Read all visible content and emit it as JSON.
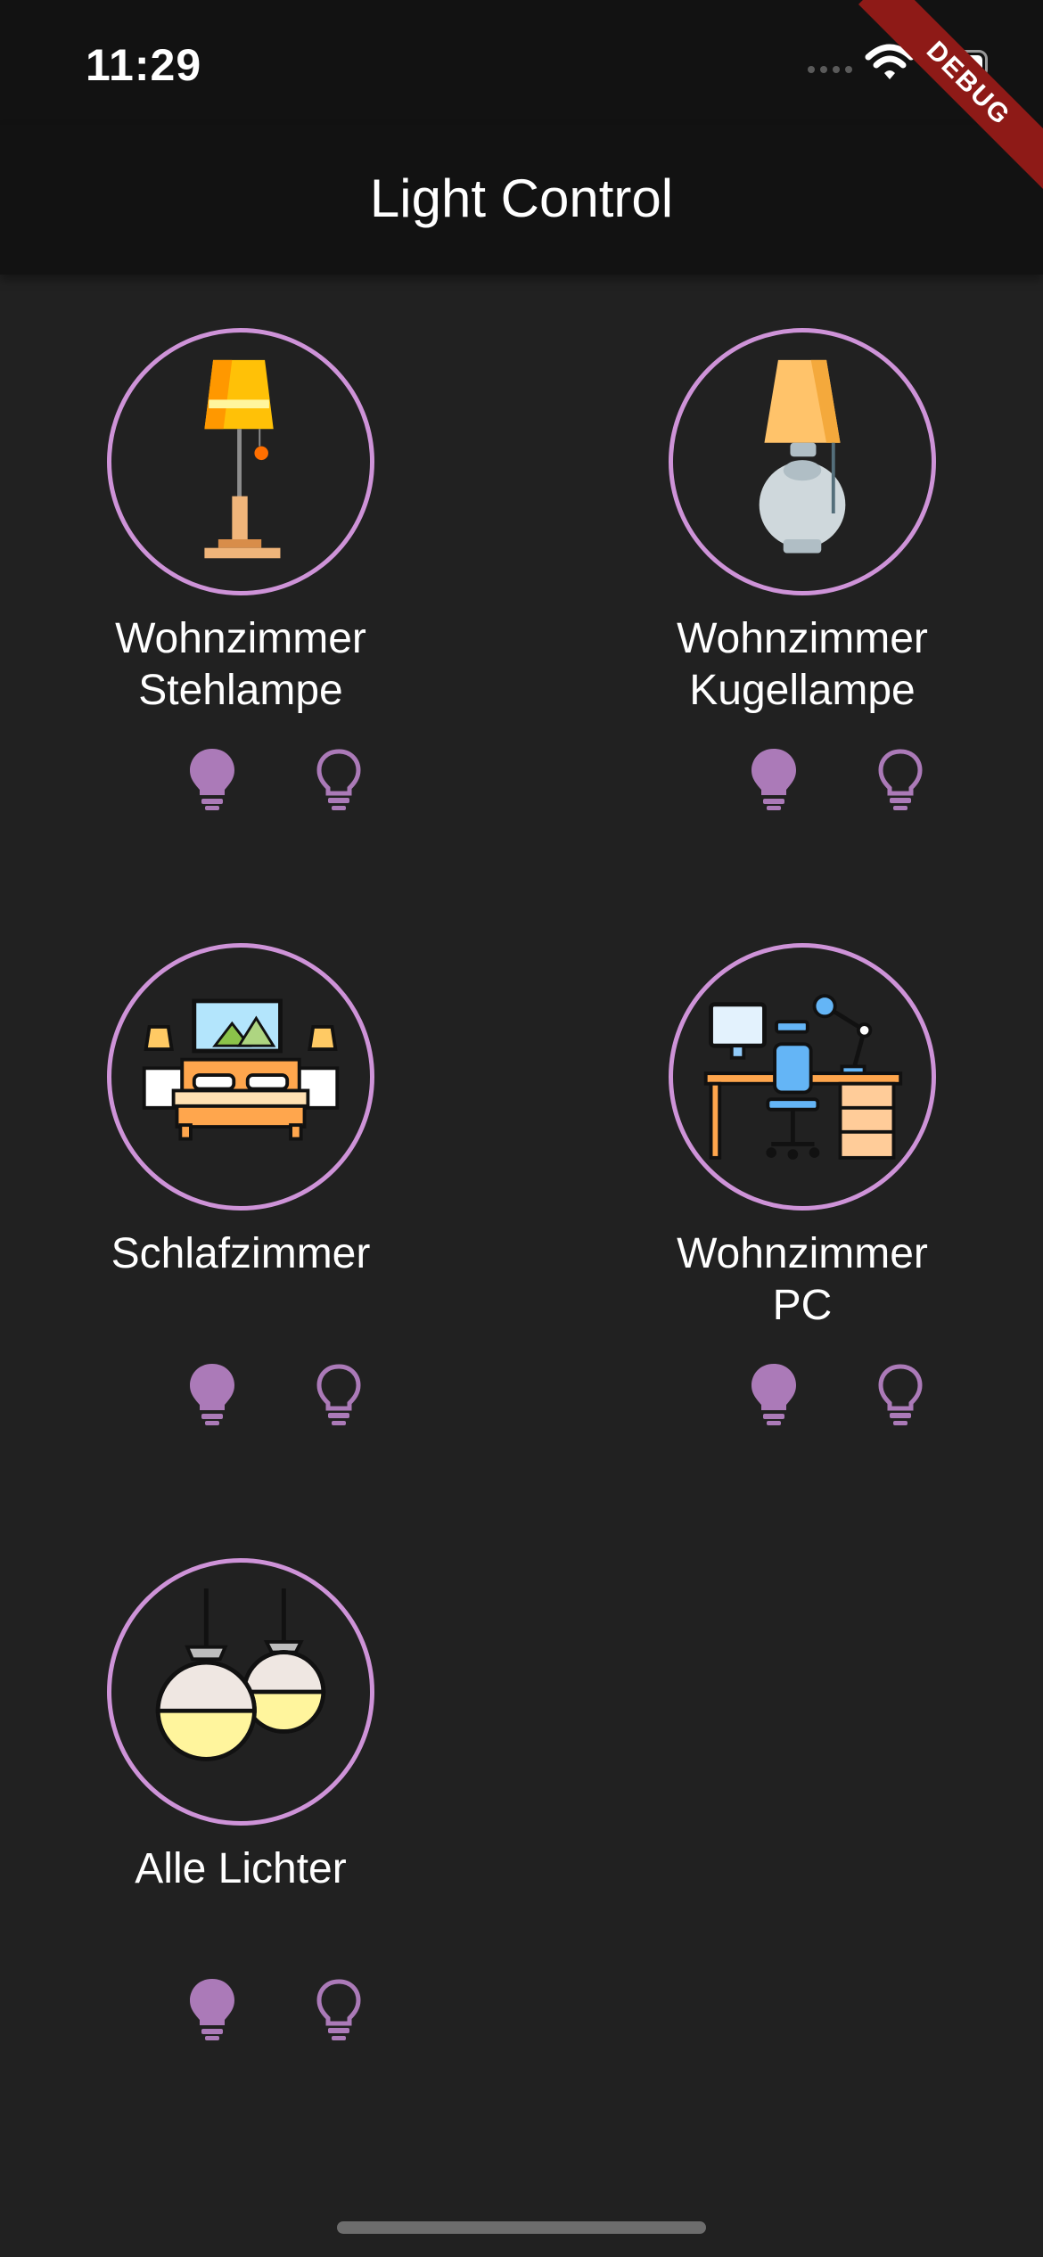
{
  "status_bar": {
    "time": "11:29"
  },
  "debug_banner": "DEBUG",
  "app_bar": {
    "title": "Light Control"
  },
  "lights": [
    {
      "name": "Wohnzimmer\nStehlampe",
      "icon": "floor-lamp-icon"
    },
    {
      "name": "Wohnzimmer\nKugellampe",
      "icon": "table-lamp-icon"
    },
    {
      "name": "Schlafzimmer",
      "icon": "bedroom-icon"
    },
    {
      "name": "Wohnzimmer\nPC",
      "icon": "desk-workspace-icon"
    },
    {
      "name": "Alle Lichter",
      "icon": "pendant-lamps-icon"
    }
  ],
  "colors": {
    "background": "#212121",
    "app_bar": "#121212",
    "accent": "#ce93d8",
    "bulb": "#ab7ab8"
  }
}
